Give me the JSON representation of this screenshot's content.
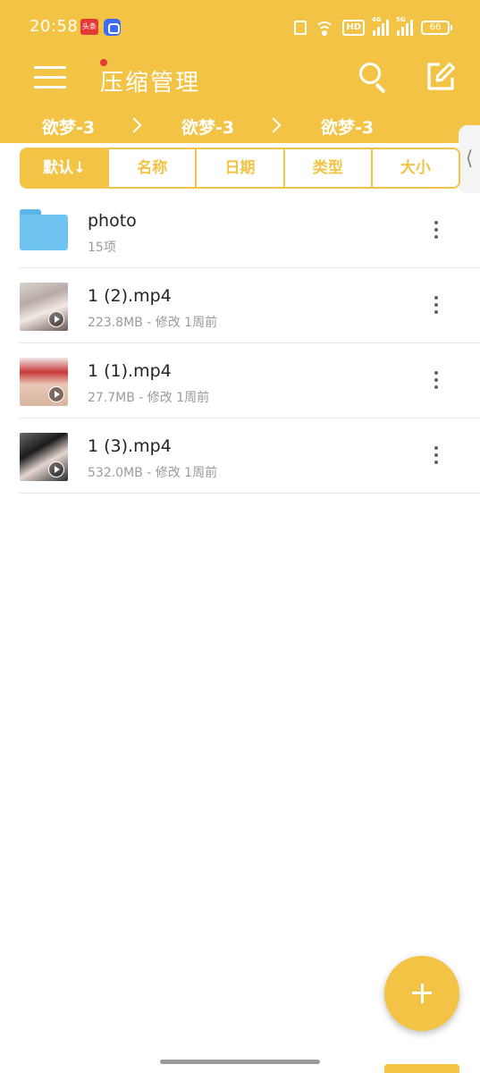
{
  "status_bar": {
    "time": "20:58",
    "app1_label": "头条",
    "hd_label": "HD",
    "sig1_label": "4G",
    "sig2_label": "5G",
    "battery": "66"
  },
  "app_bar": {
    "title": "压缩管理",
    "accent_color": "#f2c344",
    "breadcrumb": [
      "欲梦-3",
      "欲梦-3",
      "欲梦-3"
    ]
  },
  "sort_tabs": [
    "默认↓",
    "名称",
    "日期",
    "类型",
    "大小"
  ],
  "files": [
    {
      "name": "photo",
      "meta": "15项",
      "type": "folder"
    },
    {
      "name": "1 (2).mp4",
      "meta": "223.8MB - 修改 1周前",
      "type": "video"
    },
    {
      "name": "1 (1).mp4",
      "meta": "27.7MB - 修改 1周前",
      "type": "video"
    },
    {
      "name": "1 (3).mp4",
      "meta": "532.0MB - 修改 1周前",
      "type": "video"
    }
  ],
  "fab_icon": "plus-icon"
}
